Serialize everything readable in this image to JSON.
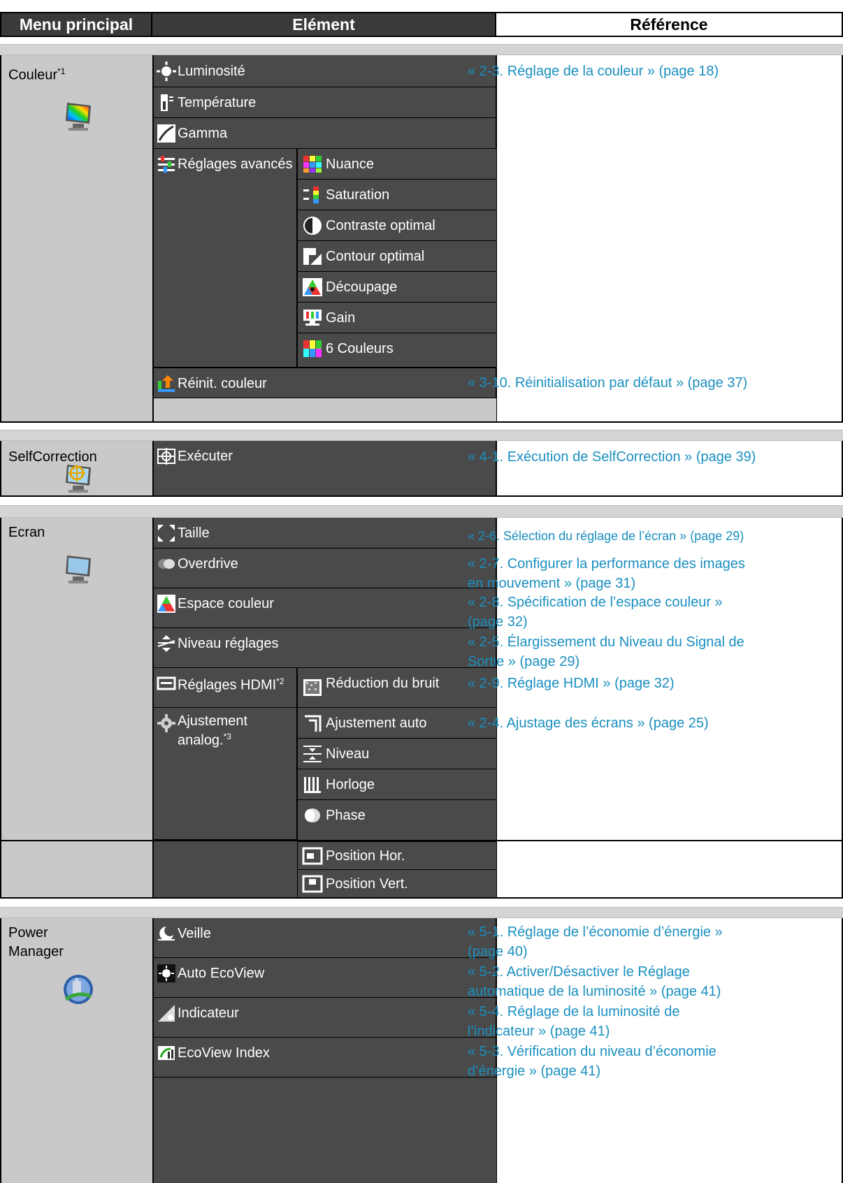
{
  "header": {
    "col_main": "Menu principal",
    "col_element": "Elément",
    "col_reference": "Référence"
  },
  "couleur": {
    "title": "Couleur",
    "note": "*1",
    "luminosite": "Luminosité",
    "temperature": "Température",
    "gamma": "Gamma",
    "reglages_avances": "Réglages avancés",
    "nuance": "Nuance",
    "saturation": "Saturation",
    "contraste": "Contraste optimal",
    "contour": "Contour optimal",
    "decoupage": "Découpage",
    "gain": "Gain",
    "six_couleurs": "6 Couleurs",
    "reinit": "Réinit. couleur",
    "ref_reglage": "« 2-3. Réglage de la couleur » (page 18)",
    "ref_reinit": "« 3-10. Réinitialisation par défaut » (page 37)"
  },
  "selfcorrection": {
    "title": "SelfCorrection",
    "executer": "Exécuter",
    "ref": "« 4-1. Exécution de SelfCorrection » (page 39)"
  },
  "ecran": {
    "title": "Ecran",
    "taille": "Taille",
    "ref_taille": "« 2-6. Sélection du réglage de l’écran » (page 29)",
    "overdrive": "Overdrive",
    "ref_overdrive_1": "« 2-7. Configurer la performance des images",
    "ref_overdrive_2": "en mouvement » (page 31)",
    "espace": "Espace couleur",
    "ref_espace_1": "« 2-8. Spécification de l’espace couleur »",
    "ref_espace_2": "(page 32)",
    "niveau_reglages": "Niveau réglages",
    "ref_niveau_1": "« 2-5. Élargissement du Niveau du Signal de",
    "ref_niveau_2": "Sortie » (page 29)",
    "hdmi": "Réglages HDMI",
    "hdmi_note": "*2",
    "reduction": "Réduction du bruit",
    "ref_hdmi": "« 2-9. Réglage HDMI » (page 32)",
    "analog": "Ajustement analog.",
    "analog_note": "*3",
    "ajust_auto": "Ajustement auto",
    "niveau": "Niveau",
    "horloge": "Horloge",
    "phase": "Phase",
    "pos_hor": "Position Hor.",
    "pos_vert": "Position Vert.",
    "ref_analog": "« 2-4. Ajustage des écrans » (page 25)"
  },
  "power": {
    "title_1": "Power",
    "title_2": "Manager",
    "veille": "Veille",
    "ref_veille_1": "« 5-1. Réglage de l’économie d’énergie »",
    "ref_veille_2": "(page 40)",
    "auto_ecoview": "Auto EcoView",
    "ref_auto_1": "« 5-2. Activer/Désactiver le Réglage",
    "ref_auto_2": "automatique de la luminosité » (page 41)",
    "indicateur": "Indicateur",
    "ref_ind_1": "« 5-4. Réglage de la luminosité de",
    "ref_ind_2": "l’indicateur » (page 41)",
    "ecoview_index": "EcoView Index",
    "ref_index_1": "« 5-3. Vérification du niveau d’économie",
    "ref_index_2": "d’énergie » (page 41)"
  }
}
